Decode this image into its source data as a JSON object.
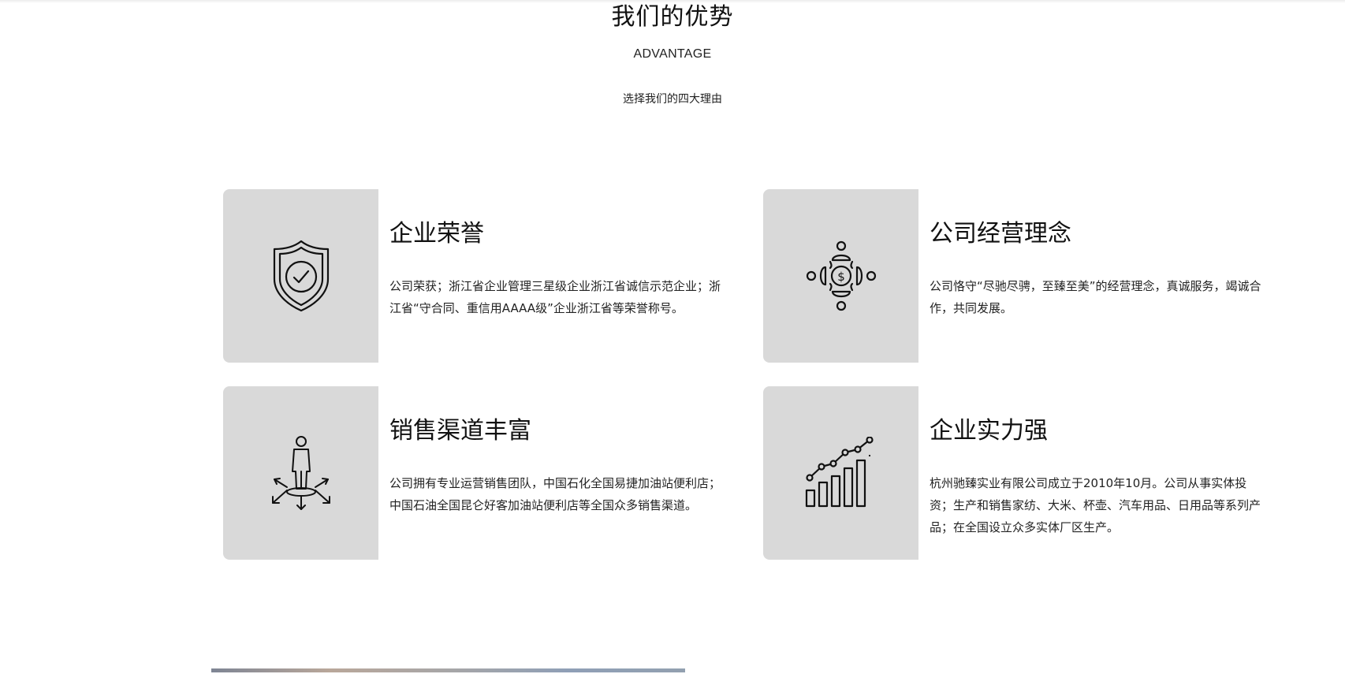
{
  "section": {
    "title": "我们的优势",
    "subtitle": "ADVANTAGE",
    "description": "选择我们的四大理由"
  },
  "cards": [
    {
      "icon": "shield-check-icon",
      "title": "企业荣誉",
      "text": "公司荣获；浙江省企业管理三星级企业浙江省诚信示范企业；浙江省“守合同、重信用AAAA级”企业浙江省等荣誉称号。"
    },
    {
      "icon": "team-money-icon",
      "title": "公司经营理念",
      "text": "公司恪守“尽驰尽骋，至臻至美”的经营理念，真诚服务，竭诚合作，共同发展。"
    },
    {
      "icon": "person-arrows-icon",
      "title": "销售渠道丰富",
      "text": "公司拥有专业运营销售团队，中国石化全国易捷加油站便利店；中国石油全国昆仑好客加油站便利店等全国众多销售渠道。"
    },
    {
      "icon": "growth-chart-icon",
      "title": "企业实力强",
      "text": "杭州驰臻实业有限公司成立于2010年10月。公司从事实体投资；生产和销售家纺、大米、杯壶、汽车用品、日用品等系列产品；在全国设立众多实体厂区生产。"
    }
  ],
  "colors": {
    "icon_box_bg": "#d9d9d9",
    "text": "#111111"
  }
}
